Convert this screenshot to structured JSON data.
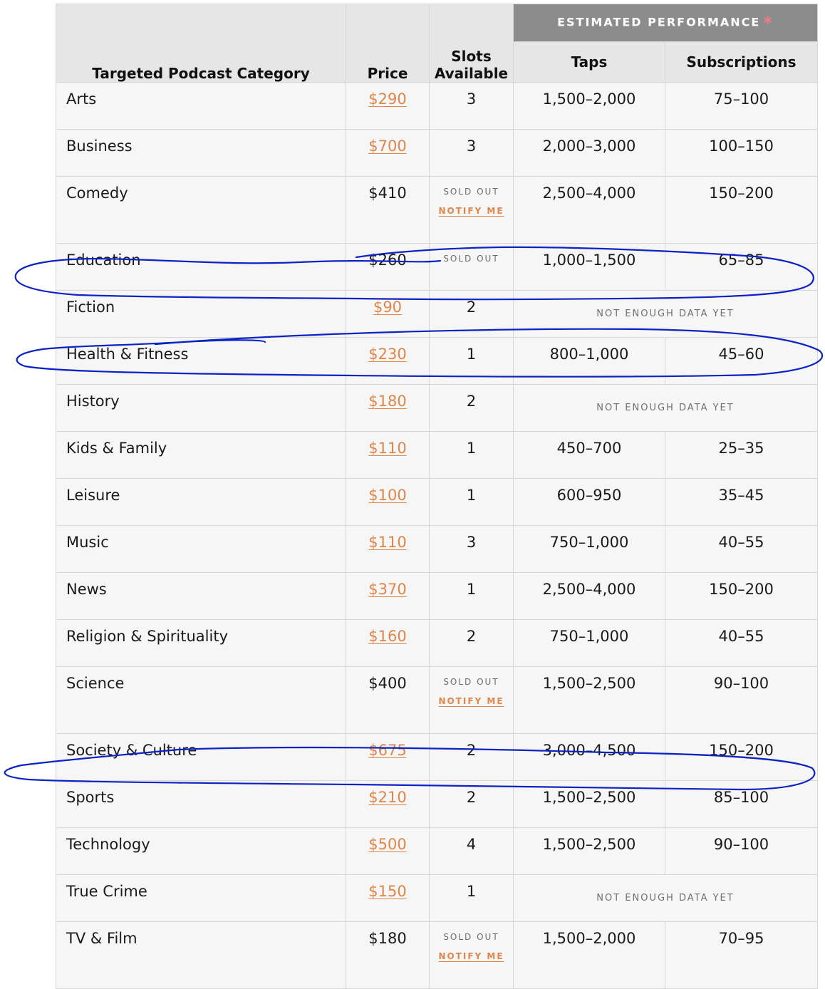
{
  "header": {
    "category": "Targeted Podcast Category",
    "price": "Price",
    "slots_line1": "Slots",
    "slots_line2": "Available",
    "performance": "ESTIMATED PERFORMANCE",
    "performance_star": "*",
    "taps": "Taps",
    "subscriptions": "Subscriptions"
  },
  "labels": {
    "sold_out": "SOLD OUT",
    "notify_me": "NOTIFY ME",
    "not_enough_data": "NOT ENOUGH DATA YET"
  },
  "colors": {
    "accent": "#e0864a",
    "header_dark": "#8c8c8c",
    "annotation": "#0b22c4"
  },
  "rows": [
    {
      "category": "Arts",
      "price": "$290",
      "linked": true,
      "slots": "3",
      "taps": "1,500–2,000",
      "subs": "75–100"
    },
    {
      "category": "Business",
      "price": "$700",
      "linked": true,
      "slots": "3",
      "taps": "2,000–3,000",
      "subs": "100–150"
    },
    {
      "category": "Comedy",
      "price": "$410",
      "linked": false,
      "sold_out": true,
      "notify": true,
      "taps": "2,500–4,000",
      "subs": "150–200"
    },
    {
      "category": "Education",
      "price": "$260",
      "linked": false,
      "sold_out": true,
      "notify": false,
      "taps": "1,000–1,500",
      "subs": "65–85"
    },
    {
      "category": "Fiction",
      "price": "$90",
      "linked": true,
      "slots": "2",
      "no_data": true
    },
    {
      "category": "Health & Fitness",
      "price": "$230",
      "linked": true,
      "slots": "1",
      "taps": "800–1,000",
      "subs": "45–60"
    },
    {
      "category": "History",
      "price": "$180",
      "linked": true,
      "slots": "2",
      "no_data": true
    },
    {
      "category": "Kids & Family",
      "price": "$110",
      "linked": true,
      "slots": "1",
      "taps": "450–700",
      "subs": "25–35"
    },
    {
      "category": "Leisure",
      "price": "$100",
      "linked": true,
      "slots": "1",
      "taps": "600–950",
      "subs": "35–45"
    },
    {
      "category": "Music",
      "price": "$110",
      "linked": true,
      "slots": "3",
      "taps": "750–1,000",
      "subs": "40–55"
    },
    {
      "category": "News",
      "price": "$370",
      "linked": true,
      "slots": "1",
      "taps": "2,500–4,000",
      "subs": "150–200"
    },
    {
      "category": "Religion & Spirituality",
      "price": "$160",
      "linked": true,
      "slots": "2",
      "taps": "750–1,000",
      "subs": "40–55"
    },
    {
      "category": "Science",
      "price": "$400",
      "linked": false,
      "sold_out": true,
      "notify": true,
      "taps": "1,500–2,500",
      "subs": "90–100"
    },
    {
      "category": "Society & Culture",
      "price": "$675",
      "linked": true,
      "slots": "2",
      "taps": "3,000–4,500",
      "subs": "150–200"
    },
    {
      "category": "Sports",
      "price": "$210",
      "linked": true,
      "slots": "2",
      "taps": "1,500–2,500",
      "subs": "85–100"
    },
    {
      "category": "Technology",
      "price": "$500",
      "linked": true,
      "slots": "4",
      "taps": "1,500–2,500",
      "subs": "90–100"
    },
    {
      "category": "True Crime",
      "price": "$150",
      "linked": true,
      "slots": "1",
      "no_data": true
    },
    {
      "category": "TV & Film",
      "price": "$180",
      "linked": false,
      "sold_out": true,
      "notify": true,
      "taps": "1,500–2,000",
      "subs": "70–95"
    }
  ]
}
